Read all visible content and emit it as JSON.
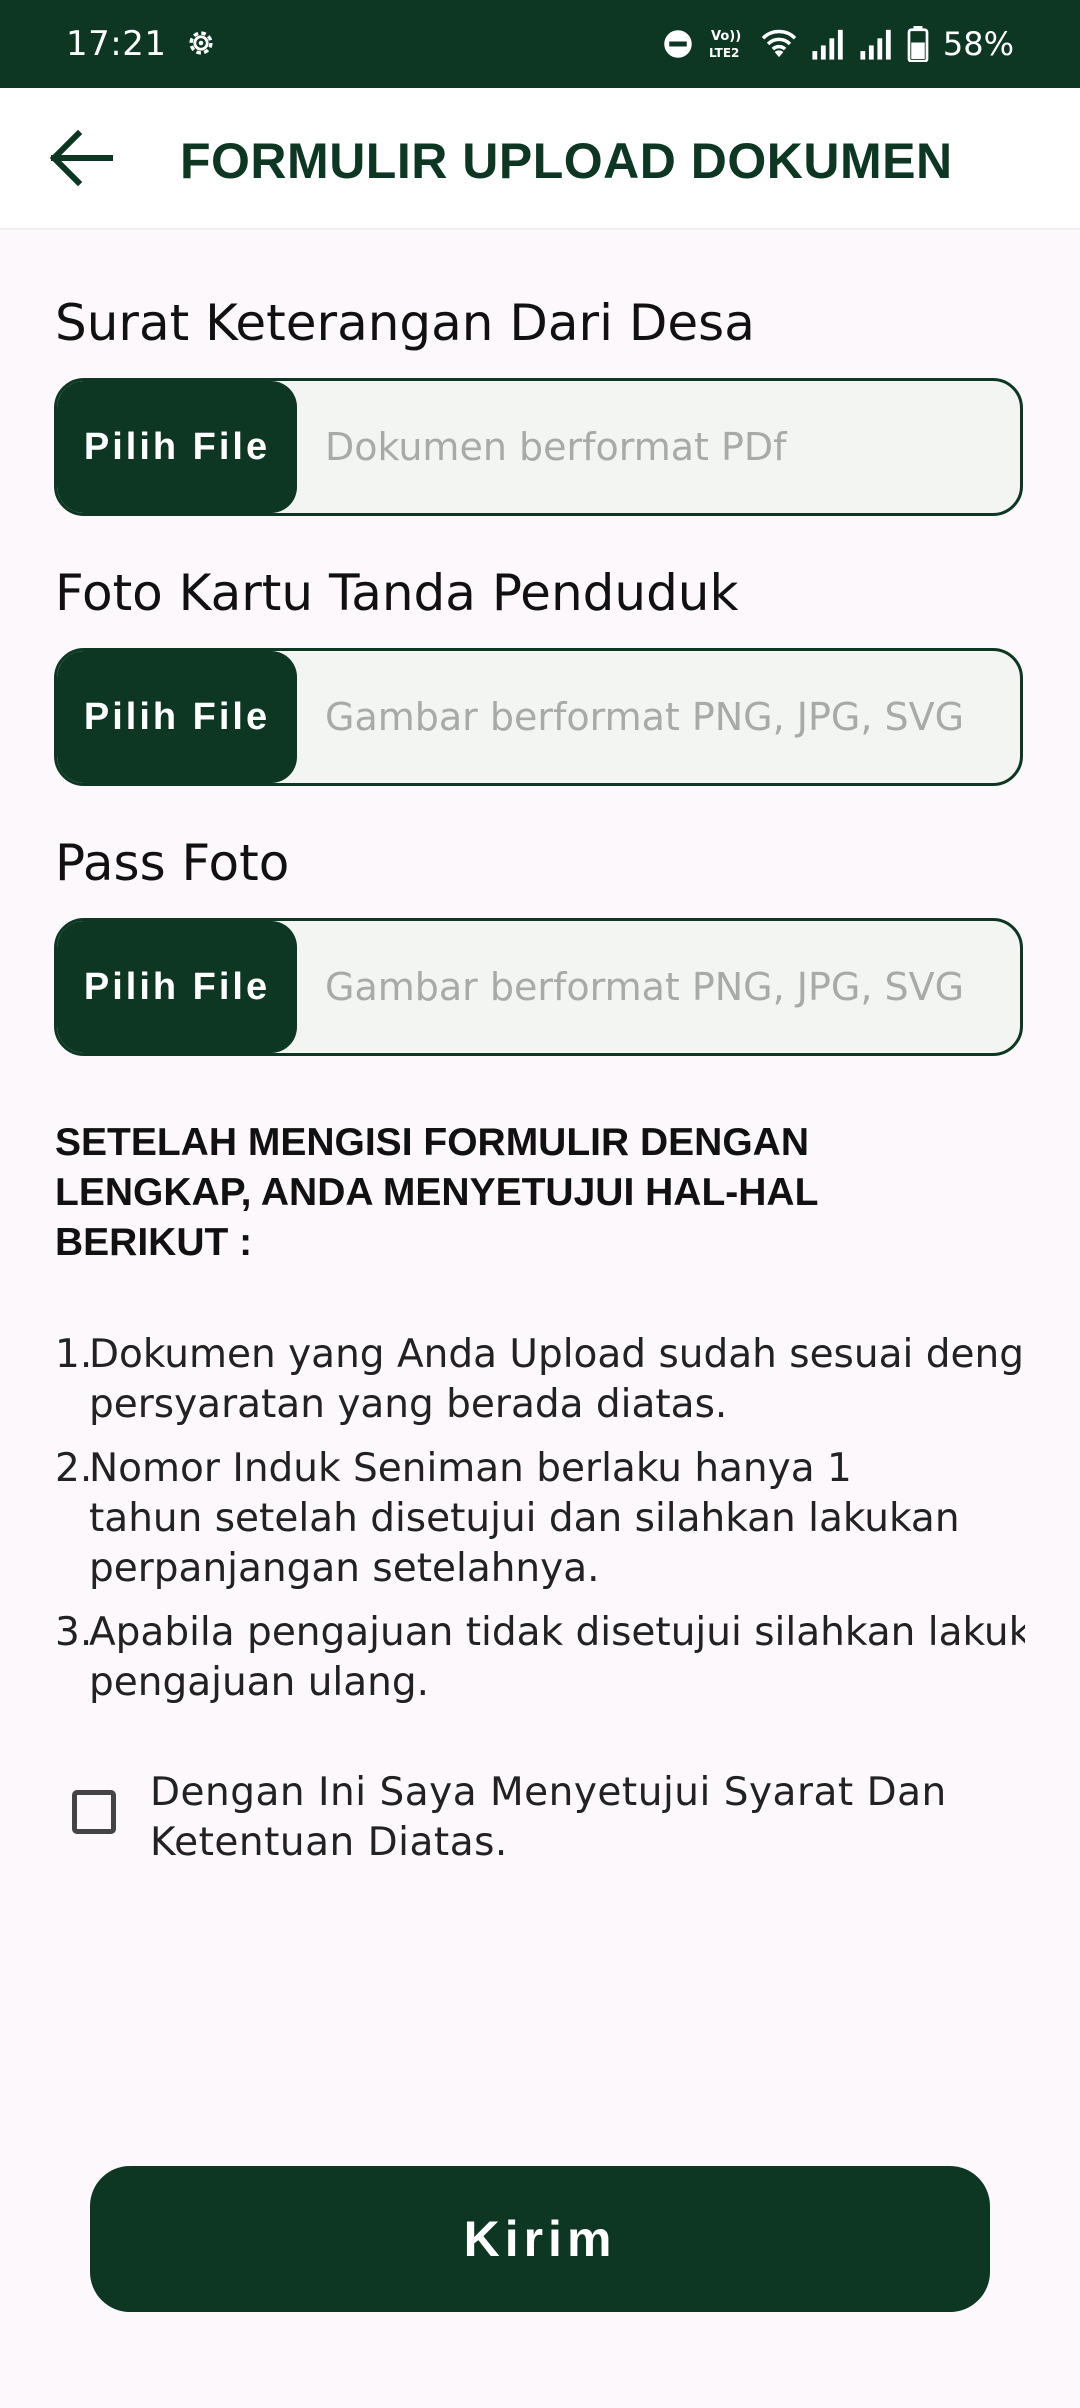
{
  "status_bar": {
    "time": "17:21",
    "battery": "58%",
    "icons": [
      "settings-gear-icon",
      "do-not-disturb-icon",
      "volte-icon",
      "wifi-icon",
      "signal-icon",
      "signal-icon",
      "battery-icon"
    ],
    "network_label": "LTE2"
  },
  "header": {
    "title": "FORMULIR UPLOAD DOKUMEN",
    "back_icon": "arrow-left-icon"
  },
  "form": {
    "fields": [
      {
        "label": "Surat Keterangan Dari Desa",
        "button": "Pilih File",
        "placeholder": "Dokumen berformat PDf"
      },
      {
        "label": "Foto Kartu Tanda Penduduk",
        "button": "Pilih File",
        "placeholder": "Gambar berformat PNG, JPG, SVG"
      },
      {
        "label": "Pass Foto",
        "button": "Pilih File",
        "placeholder": "Gambar berformat PNG, JPG, SVG"
      }
    ]
  },
  "terms": {
    "heading": "SETELAH MENGISI FORMULIR DENGAN LENGKAP, ANDA MENYETUJUI HAL-HAL BERIKUT :",
    "items": [
      {
        "num": "1.",
        "text": "Dokumen yang Anda Upload sudah sesuai dengan\npersyaratan yang berada diatas."
      },
      {
        "num": "2.",
        "text": "Nomor Induk Seniman berlaku hanya 1\ntahun setelah disetujui dan silahkan lakukan\nperpanjangan setelahnya."
      },
      {
        "num": "3.",
        "text": "Apabila pengajuan tidak disetujui silahkan lakukan\npengajuan ulang."
      }
    ],
    "agree_label": "Dengan Ini Saya Menyetujui Syarat Dan Ketentuan Diatas.",
    "agree_checked": false
  },
  "submit": {
    "label": "Kirim"
  },
  "colors": {
    "primary": "#0d3623",
    "background": "#fdf8fc",
    "hint": "#a8aaa8"
  }
}
